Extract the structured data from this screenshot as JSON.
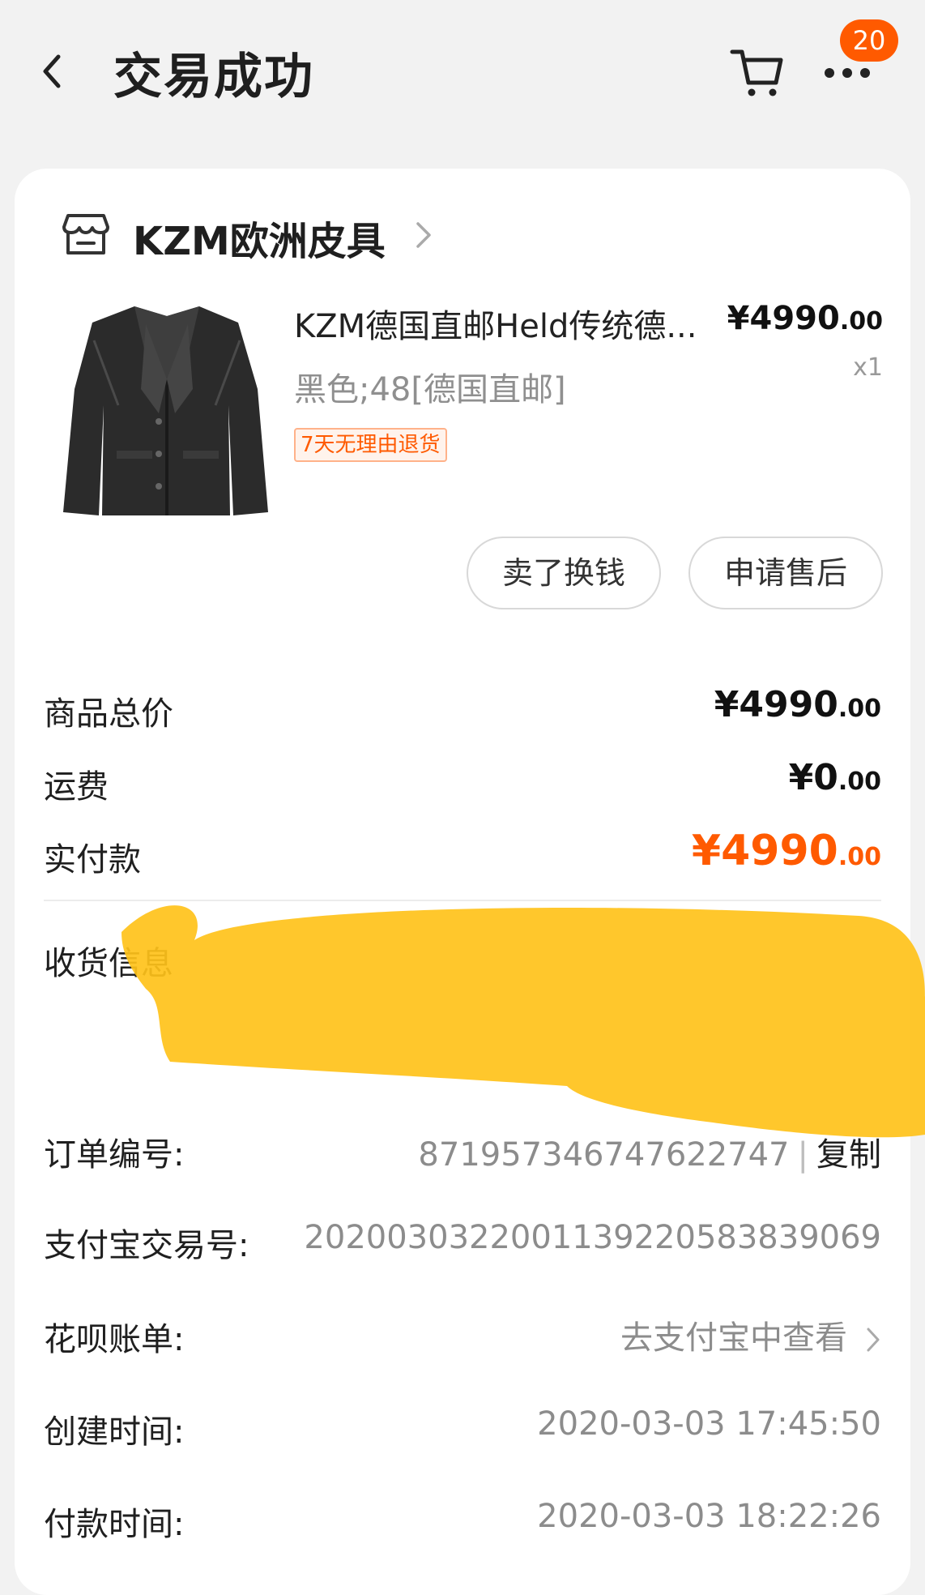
{
  "header": {
    "title": "交易成功",
    "badge_count": "20"
  },
  "store": {
    "name": "KZM欧洲皮具"
  },
  "product": {
    "title": "KZM德国直邮Held传统德...",
    "price_main": "¥4990",
    "price_dec": ".00",
    "quantity": "x1",
    "spec": "黑色;48[德国直邮]",
    "return_tag": "7天无理由退货"
  },
  "actions": {
    "sell_label": "卖了换钱",
    "aftersale_label": "申请售后"
  },
  "summary": {
    "total_label": "商品总价",
    "total_main": "¥4990",
    "total_dec": ".00",
    "shipping_label": "运费",
    "shipping_main": "¥0",
    "shipping_dec": ".00",
    "paid_label": "实付款",
    "paid_main": "¥4990",
    "paid_dec": ".00"
  },
  "shipping_info": {
    "label": "收货信息"
  },
  "details": {
    "order_no_label": "订单编号:",
    "order_no": "871957346747622747",
    "copy_label": "复制",
    "alipay_label": "支付宝交易号:",
    "alipay_no": "2020030322001139220583839069",
    "huabei_label": "花呗账单:",
    "huabei_value": "去支付宝中查看",
    "created_label": "创建时间:",
    "created_value": "2020-03-03 17:45:50",
    "paid_time_label": "付款时间:",
    "paid_time_value": "2020-03-03 18:22:26"
  },
  "colors": {
    "accent": "#ff5a00",
    "redaction": "#ffc21a"
  }
}
